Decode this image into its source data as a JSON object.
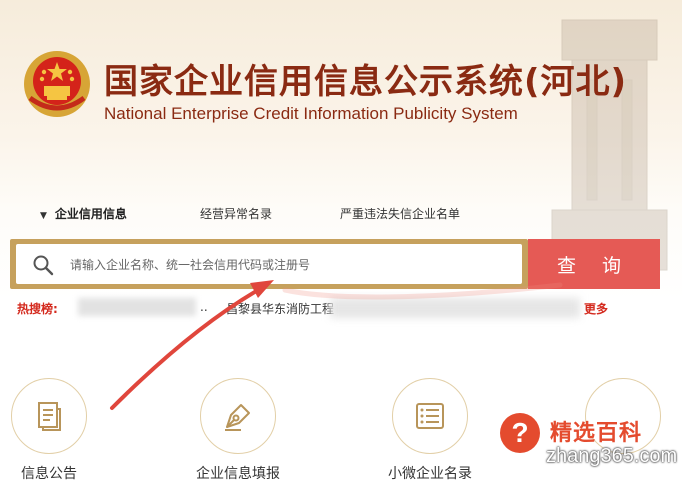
{
  "header": {
    "title_zh": "国家企业信用信息公示系统(河北)",
    "title_en": "National Enterprise Credit Information Publicity System"
  },
  "nav": {
    "items": [
      {
        "label": "企业信用信息",
        "active": true
      },
      {
        "label": "经营异常名录",
        "active": false
      },
      {
        "label": "严重违法失信企业名单",
        "active": false
      }
    ]
  },
  "search": {
    "placeholder": "请输入企业名称、统一社会信用代码或注册号",
    "button_label": "查 询"
  },
  "hot_search": {
    "label": "热搜榜:",
    "items": [
      "..",
      "昌黎县华东消防工程"
    ],
    "more": "更多"
  },
  "cards": [
    {
      "label": "信息公告",
      "icon": "document-icon"
    },
    {
      "label": "企业信息填报",
      "icon": "pen-nib-icon"
    },
    {
      "label": "小微企业名录",
      "icon": "list-icon"
    }
  ],
  "watermark": {
    "name": "精选百科",
    "url": "zhang365.com",
    "icon": "question-icon"
  },
  "colors": {
    "title": "#8a2a12",
    "search_border": "#c6a15d",
    "search_button": "#e55a55",
    "hot_label": "#d42a1e",
    "annotation_arrow": "#e0463c"
  }
}
